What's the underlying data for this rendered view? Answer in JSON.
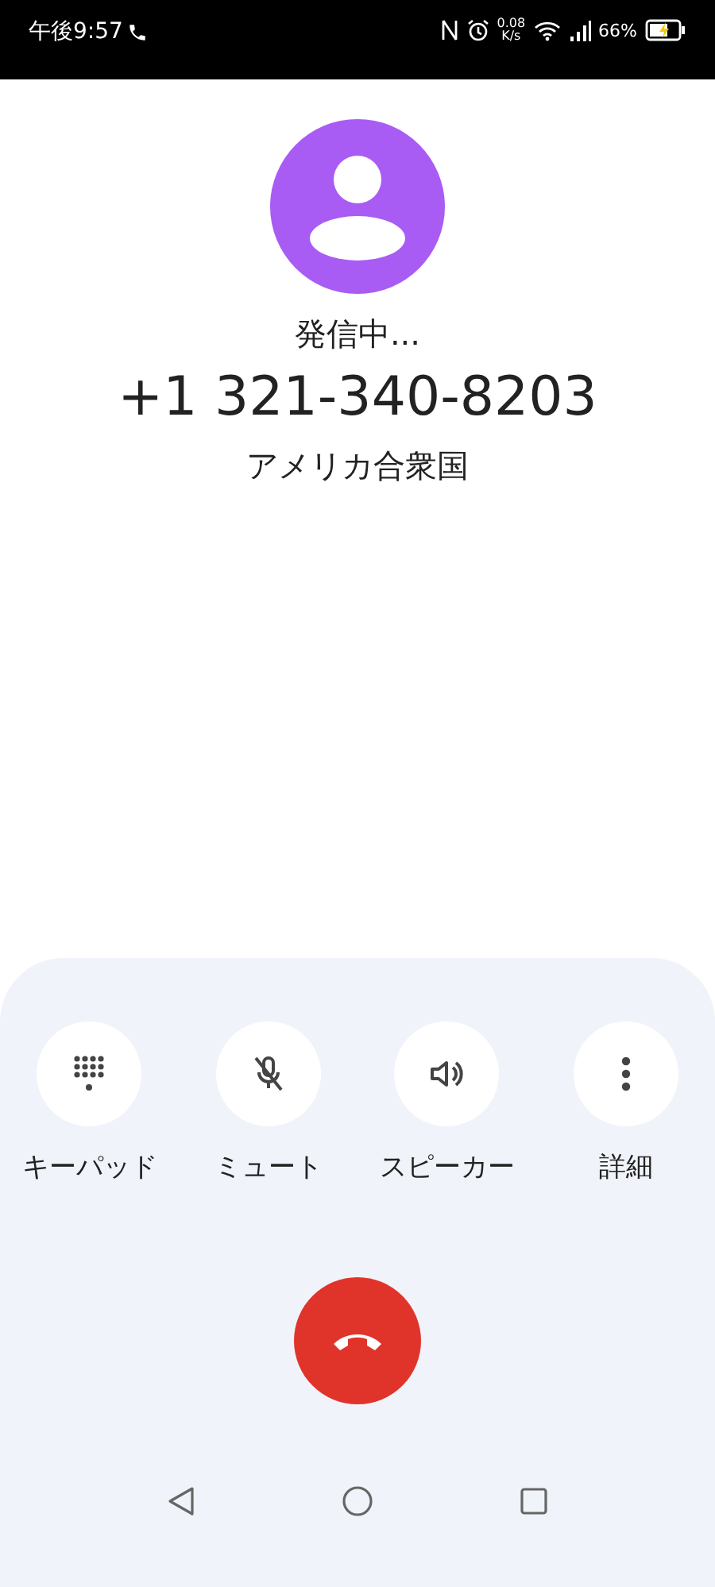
{
  "status_bar": {
    "time": "午後9:57",
    "speed": "0.08",
    "speed_unit": "K/s",
    "battery": "66%"
  },
  "call": {
    "status": "発信中...",
    "number": "+1 321-340-8203",
    "location": "アメリカ合衆国"
  },
  "actions": [
    {
      "kind": "keypad",
      "label": "キーパッド"
    },
    {
      "kind": "mute",
      "label": "ミュート"
    },
    {
      "kind": "speaker",
      "label": "スピーカー"
    },
    {
      "kind": "more",
      "label": "詳細"
    }
  ]
}
